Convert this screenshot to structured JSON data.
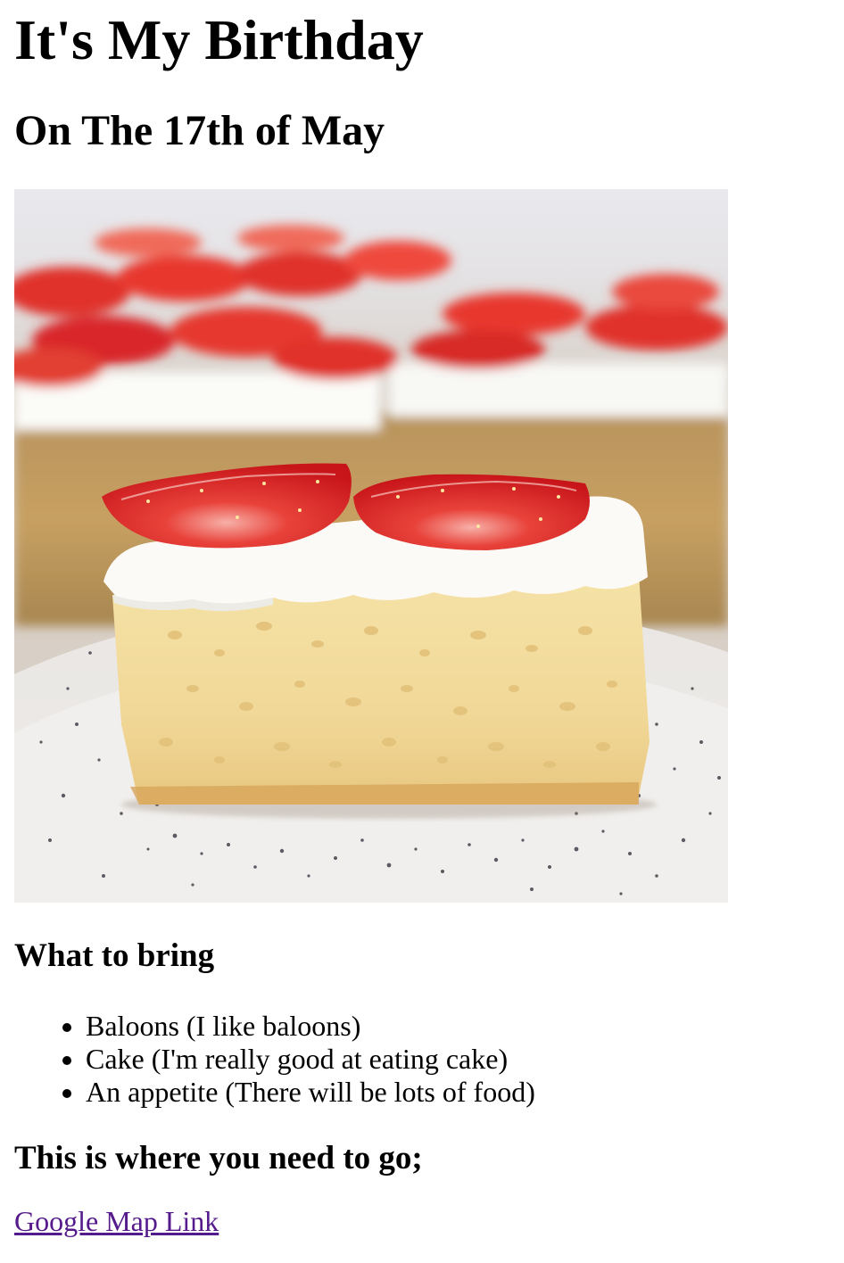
{
  "heading": "It's My Birthday",
  "subheading": "On The 17th of May",
  "image": {
    "subject": "slice of strawberry cake on speckled plate"
  },
  "bring": {
    "title": "What to bring",
    "items": [
      "Baloons (I like baloons)",
      "Cake (I'm really good at eating cake)",
      "An appetite (There will be lots of food)"
    ]
  },
  "where": {
    "title": "This is where you need to go;",
    "link_label": "Google Map Link"
  },
  "colors": {
    "link_visited": "#551a8b",
    "text": "#000000",
    "background": "#ffffff"
  }
}
